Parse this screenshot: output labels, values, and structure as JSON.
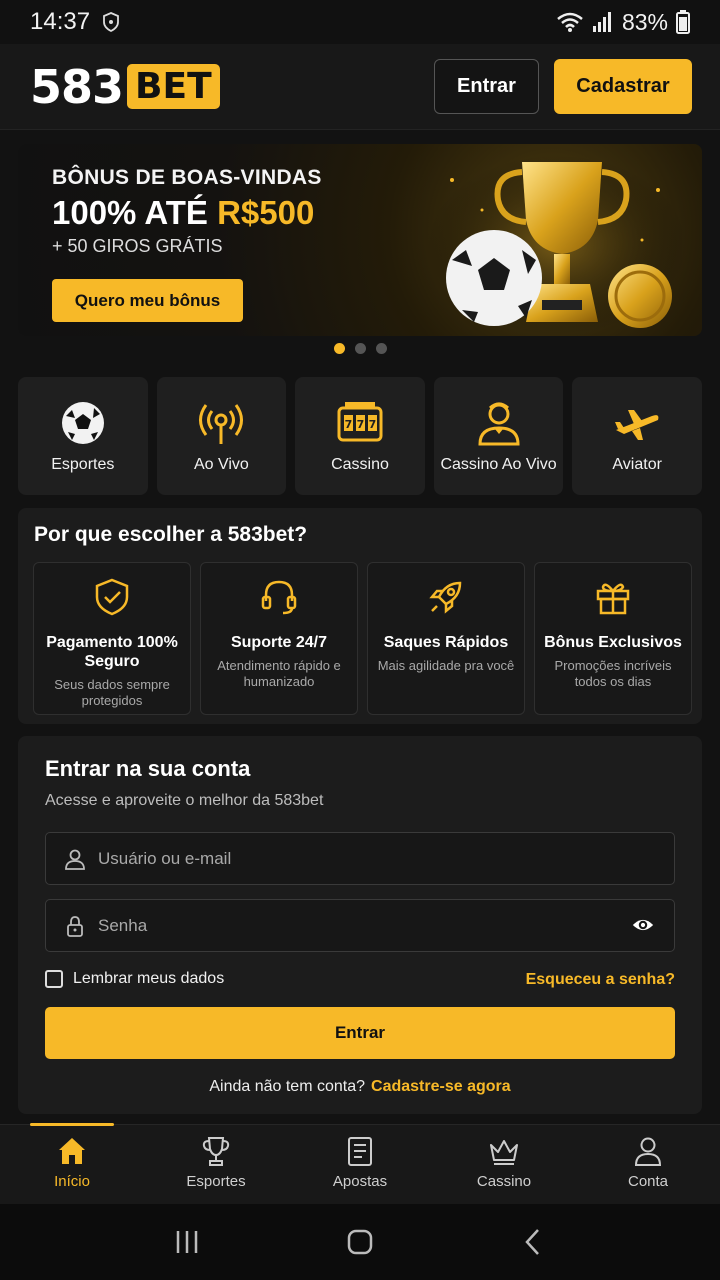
{
  "status": {
    "time": "14:37",
    "battery": "83%"
  },
  "header": {
    "logo_num": "583",
    "logo_bet": "BET",
    "login_label": "Entrar",
    "register_label": "Cadastrar"
  },
  "banner": {
    "line1": "BÔNUS DE BOAS-VINDAS",
    "line2_a": "100% ATÉ ",
    "line2_b": "R$500",
    "line3": "+ 50 GIROS GRÁTIS",
    "cta": "Quero meu bônus",
    "slides": 3,
    "active_slide": 1
  },
  "categories": [
    {
      "label": "Esportes",
      "icon": "soccer-ball-icon"
    },
    {
      "label": "Ao Vivo",
      "icon": "live-broadcast-icon"
    },
    {
      "label": "Cassino",
      "icon": "slot-machine-icon"
    },
    {
      "label": "Cassino Ao Vivo",
      "icon": "dealer-icon"
    },
    {
      "label": "Aviator",
      "icon": "airplane-icon"
    }
  ],
  "why": {
    "title": "Por que escolher a 583bet?",
    "cards": [
      {
        "title": "Pagamento 100% Seguro",
        "sub": "Seus dados sempre protegidos",
        "icon": "shield-check-icon"
      },
      {
        "title": "Suporte 24/7",
        "sub": "Atendimento rápido e humanizado",
        "icon": "headset-icon"
      },
      {
        "title": "Saques Rápidos",
        "sub": "Mais agilidade pra você",
        "icon": "rocket-icon"
      },
      {
        "title": "Bônus Exclusivos",
        "sub": "Promoções incríveis todos os dias",
        "icon": "gift-icon"
      }
    ]
  },
  "login": {
    "title": "Entrar na sua conta",
    "subtitle": "Acesse e aproveite o melhor da 583bet",
    "username_placeholder": "Usuário ou e-mail",
    "password_placeholder": "Senha",
    "remember_label": "Lembrar meus dados",
    "forgot_label": "Esqueceu a senha?",
    "submit_label": "Entrar",
    "signup_prompt": "Ainda não tem conta?",
    "signup_link": "Cadastre-se agora"
  },
  "bottom_nav": [
    {
      "label": "Início",
      "icon": "home-icon",
      "active": true
    },
    {
      "label": "Esportes",
      "icon": "trophy-icon",
      "active": false
    },
    {
      "label": "Apostas",
      "icon": "betslip-icon",
      "active": false
    },
    {
      "label": "Cassino",
      "icon": "crown-icon",
      "active": false
    },
    {
      "label": "Conta",
      "icon": "user-icon",
      "active": false
    }
  ],
  "colors": {
    "accent": "#f7b928",
    "background": "#121212",
    "card": "#1c1c1c"
  }
}
